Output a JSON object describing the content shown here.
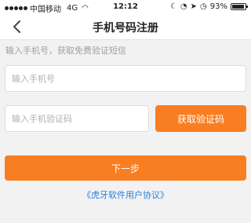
{
  "status": {
    "carrier": "中国移动",
    "network": "4G",
    "time": "12:12",
    "battery": "93%",
    "icons": [
      "moon-icon",
      "alarm-icon",
      "location-icon",
      "clock-icon"
    ]
  },
  "nav": {
    "title": "手机号码注册",
    "back_icon": "chevron-left-icon"
  },
  "hint": "输入手机号，获取免费验证短信",
  "phone_input": {
    "placeholder": "输入手机号"
  },
  "code_input": {
    "placeholder": "输入手机验证码"
  },
  "get_code_label": "获取验证码",
  "next_label": "下一步",
  "agreement_label": "《虎牙软件用户协议》",
  "colors": {
    "accent": "#f97e22",
    "link": "#2b7fd6"
  }
}
